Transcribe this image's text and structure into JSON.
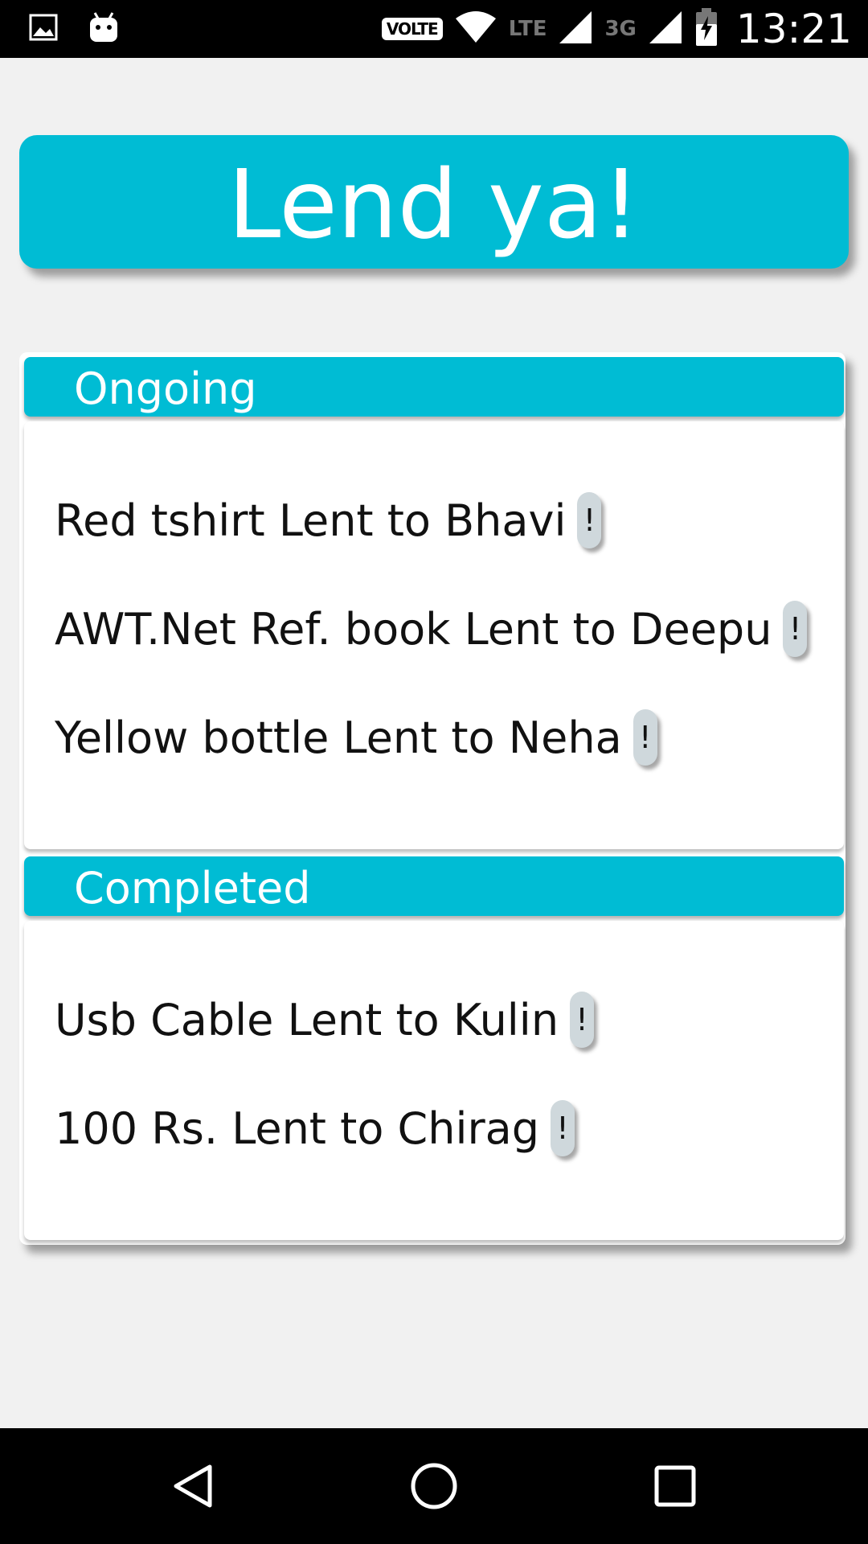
{
  "status_bar": {
    "icons_left": [
      "image-icon",
      "android-icon"
    ],
    "volte": "VOLTE",
    "lte": "LTE",
    "network_3g": "3G",
    "time": "13:21"
  },
  "app": {
    "title": "Lend ya!"
  },
  "sections": {
    "ongoing": {
      "title": "Ongoing",
      "items": [
        {
          "text": "Red tshirt Lent to Bhavi",
          "action": "!"
        },
        {
          "text": "AWT.Net Ref. book Lent to Deepu",
          "action": "!"
        },
        {
          "text": "Yellow bottle Lent to Neha",
          "action": "!"
        }
      ]
    },
    "completed": {
      "title": "Completed",
      "items": [
        {
          "text": "Usb Cable Lent to Kulin",
          "action": "!"
        },
        {
          "text": "100 Rs. Lent to Chirag",
          "action": "!"
        }
      ]
    }
  },
  "nav": {
    "icons": [
      "back-icon",
      "home-icon",
      "recents-icon"
    ]
  },
  "colors": {
    "accent": "#00bcd4",
    "background": "#f1f1f1",
    "button": "#cfd8dc"
  }
}
